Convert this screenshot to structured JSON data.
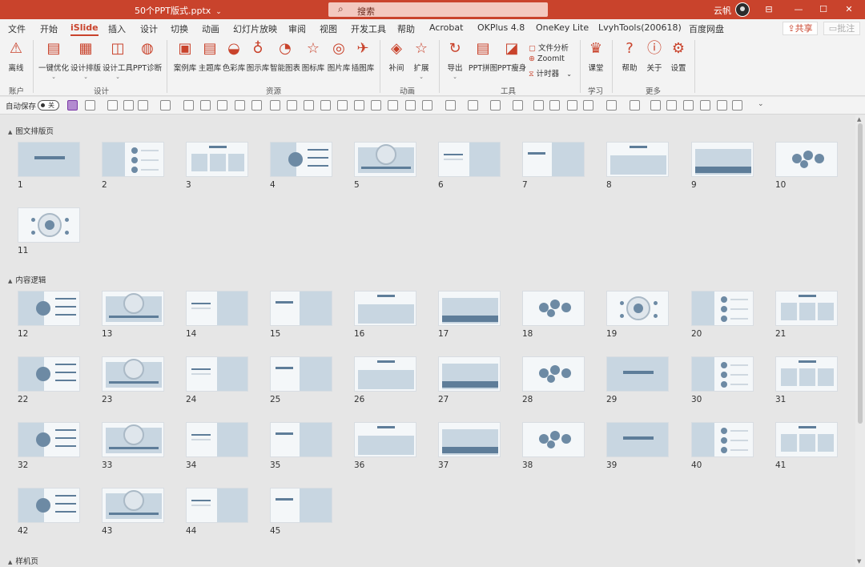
{
  "window": {
    "doc_title": "50个PPT版式.pptx",
    "search_placeholder": "搜索",
    "user_name": "云帆",
    "buttons": {
      "ribbon_display": "⊟",
      "minimize": "—",
      "maximize": "☐",
      "close": "✕"
    }
  },
  "tabs": [
    "文件",
    "开始",
    "iSlide",
    "插入",
    "设计",
    "切换",
    "动画",
    "幻灯片放映",
    "审阅",
    "视图",
    "开发工具",
    "帮助",
    "Acrobat",
    "OKPlus 4.8",
    "OneKey Lite",
    "LvyhTools(200618)",
    "百度网盘"
  ],
  "active_tab": "iSlide",
  "share_label": "共享",
  "comment_label": "批注",
  "ribbon": {
    "groups": [
      {
        "label": "账户"
      },
      {
        "label": "设计"
      },
      {
        "label": "资源"
      },
      {
        "label": "动画"
      },
      {
        "label": "工具"
      },
      {
        "label": "学习"
      },
      {
        "label": "更多"
      }
    ],
    "buttons": [
      {
        "label": "离线",
        "icon": "⚠"
      },
      {
        "label": "一键优化",
        "icon": "▤",
        "dropdown": "⌄"
      },
      {
        "label": "设计排版",
        "icon": "▦",
        "dropdown": "⌄"
      },
      {
        "label": "设计工具",
        "icon": "◫",
        "dropdown": "⌄"
      },
      {
        "label": "PPT诊断",
        "icon": "◍"
      },
      {
        "label": "案例库",
        "icon": "▣"
      },
      {
        "label": "主题库",
        "icon": "▤"
      },
      {
        "label": "色彩库",
        "icon": "◒"
      },
      {
        "label": "图示库",
        "icon": "♁"
      },
      {
        "label": "智能图表",
        "icon": "◔"
      },
      {
        "label": "图标库",
        "icon": "☆"
      },
      {
        "label": "图片库",
        "icon": "◎"
      },
      {
        "label": "插图库",
        "icon": "✈"
      },
      {
        "label": "补间",
        "icon": "◈"
      },
      {
        "label": "扩展",
        "icon": "☆",
        "dropdown": "⌄"
      },
      {
        "label": "导出",
        "icon": "↻",
        "dropdown": "⌄"
      },
      {
        "label": "PPT拼图",
        "icon": "▤"
      },
      {
        "label": "PPT瘦身",
        "icon": "◪"
      },
      {
        "label": "课堂",
        "icon": "♛"
      },
      {
        "label": "帮助",
        "icon": "?"
      },
      {
        "label": "关于",
        "icon": "ⓘ"
      },
      {
        "label": "设置",
        "icon": "⚙"
      }
    ],
    "small_buttons": [
      {
        "label": "文件分析",
        "icon": "▢"
      },
      {
        "label": "ZoomIt",
        "icon": "⊕"
      },
      {
        "label": "计时器",
        "icon": "⧖",
        "dropdown": "⌄"
      }
    ]
  },
  "qat": {
    "autosave_label": "自动保存",
    "toggle_state": "关"
  },
  "sections": [
    {
      "title": "图文排版页",
      "slides": [
        "1",
        "2",
        "3",
        "4",
        "5",
        "6",
        "7",
        "8",
        "9",
        "10",
        "11"
      ]
    },
    {
      "title": "内容逻辑",
      "slides": [
        "12",
        "13",
        "14",
        "15",
        "16",
        "17",
        "18",
        "19",
        "20",
        "21",
        "22",
        "23",
        "24",
        "25",
        "26",
        "27",
        "28",
        "29",
        "30",
        "31",
        "32",
        "33",
        "34",
        "35",
        "36",
        "37",
        "38",
        "39",
        "40",
        "41",
        "42",
        "43",
        "44",
        "45"
      ]
    },
    {
      "title": "样机页",
      "slides": []
    }
  ],
  "colors": {
    "accent": "#c9432c",
    "slide_blue": "#5e7d99",
    "slide_pale": "#c8d6e1"
  },
  "icons": {
    "section_collapse": "▲",
    "scroll_up": "▲",
    "scroll_down": "▼",
    "search": "⌕"
  }
}
